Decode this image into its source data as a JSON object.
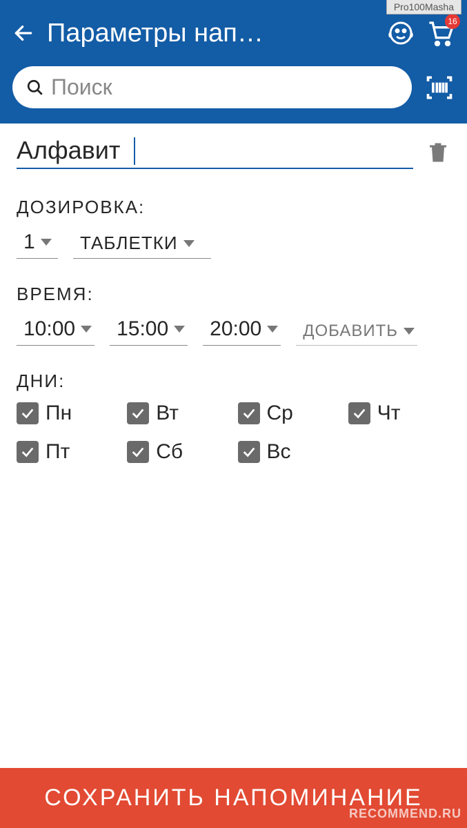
{
  "watermark_user": "Pro100Masha",
  "watermark_site": "RECOMMEND.RU",
  "header": {
    "title": "Параметры нап…",
    "cart_badge": "16"
  },
  "search": {
    "placeholder": "Поиск"
  },
  "reminder": {
    "name": "Алфавит",
    "dosage_label": "ДОЗИРОВКА:",
    "dosage_qty": "1",
    "dosage_unit": "ТАБЛЕТКИ",
    "time_label": "ВРЕМЯ:",
    "times": [
      "10:00",
      "15:00",
      "20:00"
    ],
    "add_time_label": "ДОБАВИТЬ",
    "days_label": "ДНИ:",
    "days": [
      {
        "label": "Пн",
        "checked": true
      },
      {
        "label": "Вт",
        "checked": true
      },
      {
        "label": "Ср",
        "checked": true
      },
      {
        "label": "Чт",
        "checked": true
      },
      {
        "label": "Пт",
        "checked": true
      },
      {
        "label": "Сб",
        "checked": true
      },
      {
        "label": "Вс",
        "checked": true
      }
    ]
  },
  "save_button": "СОХРАНИТЬ НАПОМИНАНИЕ"
}
